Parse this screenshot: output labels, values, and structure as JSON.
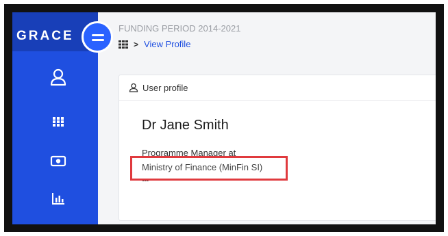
{
  "app": {
    "logo": "GRACE"
  },
  "sidebar": {
    "items": [
      {
        "icon": "user-icon"
      },
      {
        "icon": "grid-icon"
      },
      {
        "icon": "money-icon"
      },
      {
        "icon": "chart-icon"
      }
    ]
  },
  "header": {
    "period": "FUNDING PERIOD 2014-2021",
    "breadcrumb": {
      "separator": ">",
      "current": "View Profile"
    }
  },
  "profile_card": {
    "title": "User profile",
    "name": "Dr Jane Smith",
    "role": "Programme Manager at",
    "organization": "Ministry of Finance (MinFin SI)",
    "more": "•••"
  },
  "colors": {
    "sidebar": "#1f4fe0",
    "highlight": "#e03a3e",
    "link": "#1f4fe0"
  }
}
